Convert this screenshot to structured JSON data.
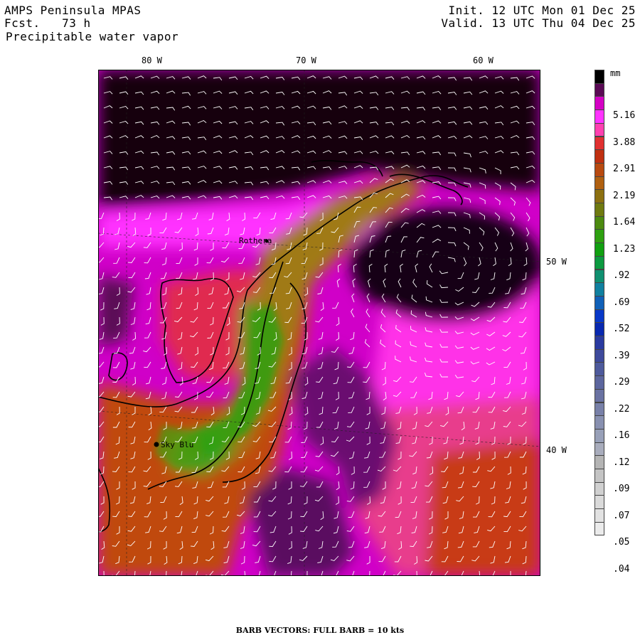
{
  "header": {
    "title": "AMPS Peninsula MPAS",
    "forecast": "Fcst.   73 h",
    "field": "Precipitable water vapor",
    "init": "Init. 12 UTC Mon 01 Dec 25",
    "valid": "Valid. 13 UTC Thu 04 Dec 25"
  },
  "map": {
    "lon_labels_top": [
      "80 W",
      "70 W",
      "60 W"
    ],
    "lon_labels_right": [
      "50 W",
      "40 W"
    ],
    "stations": [
      {
        "name": "Rothera"
      },
      {
        "name": "Sky Blu"
      }
    ]
  },
  "colorbar": {
    "unit": "mm",
    "labels": [
      "5.16",
      "3.88",
      "2.91",
      "2.19",
      "1.64",
      "1.23",
      ".92",
      ".69",
      ".52",
      ".39",
      ".29",
      ".22",
      ".16",
      ".12",
      ".09",
      ".07",
      ".05",
      ".04"
    ],
    "colors": [
      "#000000",
      "#5a0a55",
      "#d400c4",
      "#ff33ff",
      "#ff40b0",
      "#e03030",
      "#c03010",
      "#b84a10",
      "#b06010",
      "#8c7010",
      "#6f7a10",
      "#4c8a10",
      "#2ea010",
      "#10a010",
      "#0c9a40",
      "#109070",
      "#1080a0",
      "#1060b8",
      "#0838c8",
      "#0828b0",
      "#2a3aa0",
      "#3e4a9c",
      "#4e5a9c",
      "#5c669e",
      "#6a72a2",
      "#7880a8",
      "#8890b0",
      "#98a0b8",
      "#a8acbc",
      "#b4b4b4",
      "#c4c4c4",
      "#d0d0d0",
      "#dadada",
      "#e2e2e2",
      "#ebebeb"
    ]
  },
  "footer": {
    "text": "BARB VECTORS:  FULL BARB = 10 kts"
  }
}
